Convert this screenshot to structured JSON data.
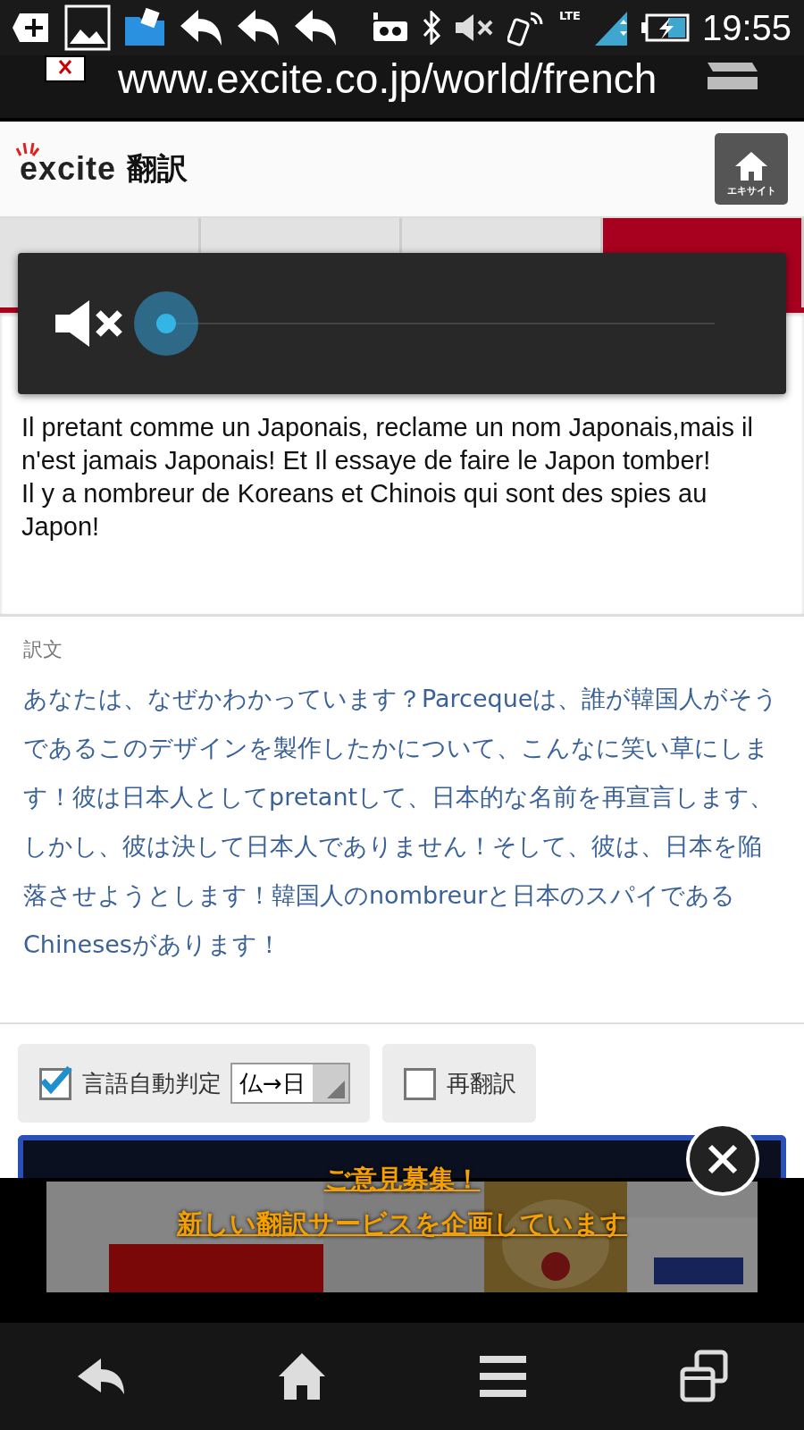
{
  "status_bar": {
    "time": "19:55",
    "network": "LTE"
  },
  "address_bar": {
    "url": "www.excite.co.jp/world/french"
  },
  "header": {
    "logo": "excite",
    "title": "翻訳",
    "home_button": "エキサイト"
  },
  "tabs": [
    {
      "selected": false
    },
    {
      "selected": false
    },
    {
      "selected": false
    },
    {
      "selected": true
    }
  ],
  "volume": {
    "muted": true
  },
  "source_text": [
    "Il pretant comme un Japonais, reclame un nom Japonais,mais il n'est jamais Japonais! Et Il essaye de faire le Japon tomber!",
    "Il y a nombreur de Koreans et Chinois qui sont des spies au Japon!"
  ],
  "result": {
    "label": "訳文",
    "text": "あなたは、なぜかわかっています？Parcequeは、誰が韓国人がそうであるこのデザインを製作したかについて、こんなに笑い草にします！彼は日本人としてpretantして、日本的な名前を再宣言します、しかし、彼は決して日本人でありません！そして、彼は、日本を陥落させようとします！韓国人のnombreurと日本のスパイであるChinesesがあります！"
  },
  "options": {
    "auto_detect": {
      "label": "言語自動判定",
      "checked": true,
      "value": "仏→日"
    },
    "retranslate": {
      "label": "再翻訳",
      "checked": false
    }
  },
  "banner": {
    "lines": [
      "ご意見募集！",
      "新しい翻訳サービスを企画しています"
    ]
  }
}
